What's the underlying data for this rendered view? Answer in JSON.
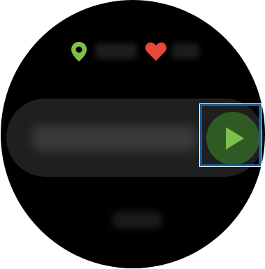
{
  "colors": {
    "background": "#000000",
    "pill": "#1f1f1f",
    "accent_green": "#7ec14a",
    "button_green": "#2f5a24",
    "heart_red": "#e8473a",
    "highlight_frame": "#1a5c9a"
  },
  "status_row": {
    "location_icon": "location-pin-icon",
    "heart_icon": "heart-icon"
  },
  "workout_item": {
    "start_button_icon": "play-icon"
  }
}
